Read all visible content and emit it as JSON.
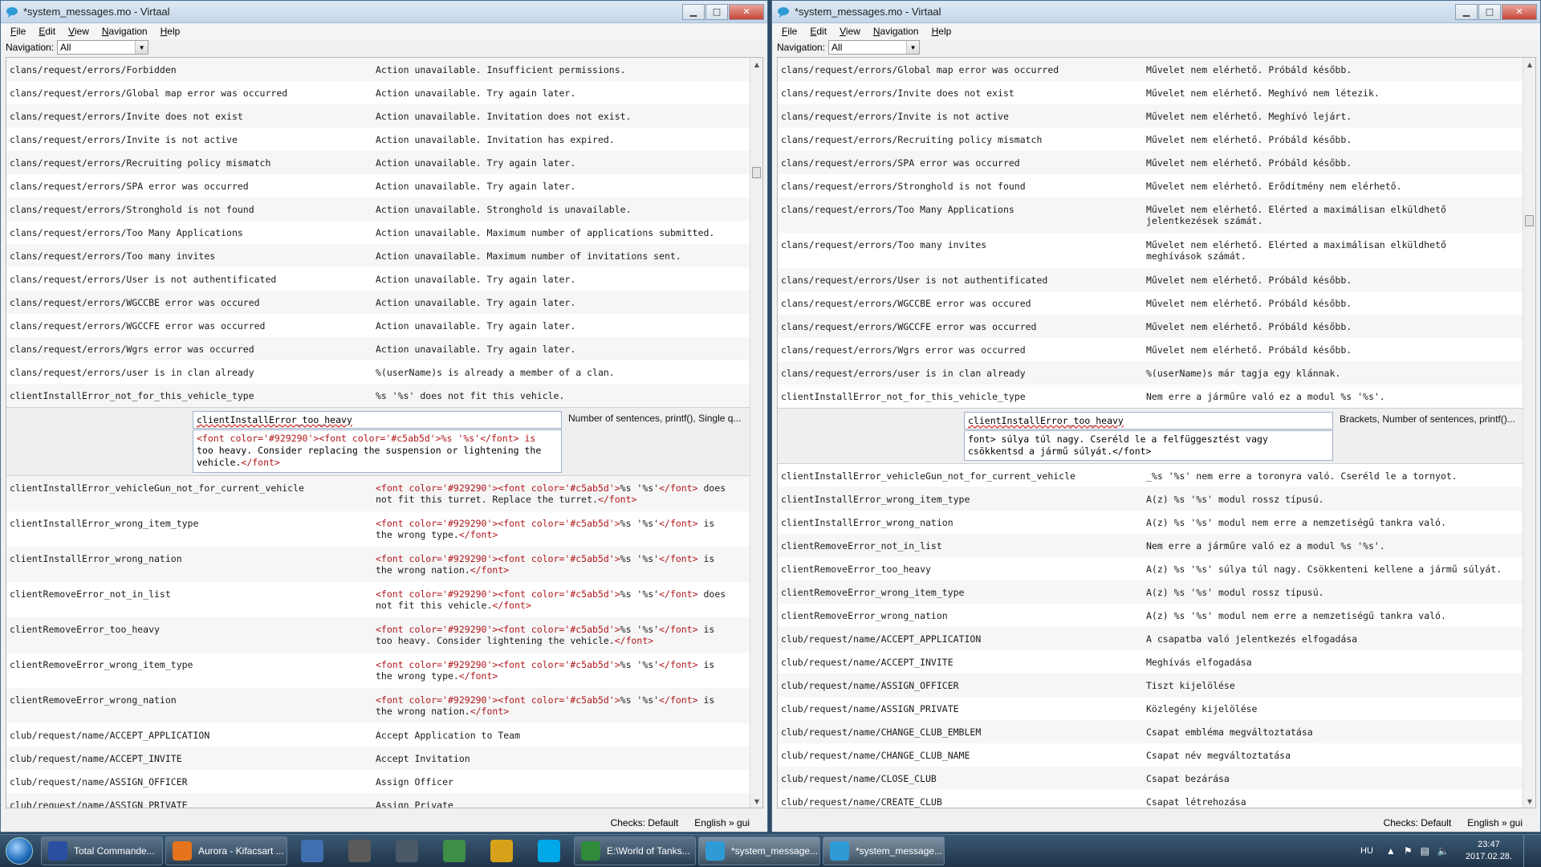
{
  "left_window": {
    "title": "*system_messages.mo - Virtaal",
    "menu": [
      "File",
      "Edit",
      "View",
      "Navigation",
      "Help"
    ],
    "nav_label": "Navigation:",
    "nav_value": "All",
    "rows_before": [
      {
        "key": "clans/request/errors/Forbidden",
        "val": "Action unavailable. Insufficient permissions."
      },
      {
        "key": "clans/request/errors/Global map error was occurred",
        "val": "Action unavailable. Try again later."
      },
      {
        "key": "clans/request/errors/Invite does not exist",
        "val": "Action unavailable. Invitation does not exist."
      },
      {
        "key": "clans/request/errors/Invite is not active",
        "val": "Action unavailable. Invitation has expired."
      },
      {
        "key": "clans/request/errors/Recruiting policy mismatch",
        "val": "Action unavailable. Try again later."
      },
      {
        "key": "clans/request/errors/SPA error was occurred",
        "val": "Action unavailable. Try again later."
      },
      {
        "key": "clans/request/errors/Stronghold is not found",
        "val": "Action unavailable. Stronghold is unavailable."
      },
      {
        "key": "clans/request/errors/Too Many Applications",
        "val": "Action unavailable. Maximum number of applications submitted."
      },
      {
        "key": "clans/request/errors/Too many invites",
        "val": "Action unavailable. Maximum number of invitations sent."
      },
      {
        "key": "clans/request/errors/User is not authentificated",
        "val": "Action unavailable. Try again later."
      },
      {
        "key": "clans/request/errors/WGCCBE error was occured",
        "val": "Action unavailable. Try again later."
      },
      {
        "key": "clans/request/errors/WGCCFE error was occurred",
        "val": "Action unavailable. Try again later."
      },
      {
        "key": "clans/request/errors/Wgrs error was occurred",
        "val": "Action unavailable. Try again later."
      },
      {
        "key": "clans/request/errors/user is in clan already",
        "val": "%(userName)s is already a member of a clan."
      },
      {
        "key": "clientInstallError_not_for_this_vehicle_type",
        "val": "%s '%s' does not fit this vehicle."
      }
    ],
    "editor": {
      "key": "clientInstallError_too_heavy",
      "val_markup": "<font color='#929290'><font color='#c5ab5d'>%s '%s'</font> is",
      "val_rest": "too heavy. Consider replacing the suspension or lightening the",
      "val_end_text": "vehicle.",
      "val_end_tag": "</font>",
      "checks": "Number of sentences, printf(), Single q..."
    },
    "rows_after": [
      {
        "key": "clientInstallError_vehicleGun_not_for_current_vehicle",
        "tag": "<font color='#929290'><font color='#c5ab5d'>",
        "mid": "%s '%s'",
        "close": "</font>",
        "text": " does",
        "text2": "not fit this turret. Replace the turret.",
        "endtag": "</font>"
      },
      {
        "key": "clientInstallError_wrong_item_type",
        "tag": "<font color='#929290'><font color='#c5ab5d'>",
        "mid": "%s '%s'",
        "close": "</font>",
        "text": " is",
        "text2": "the wrong type.",
        "endtag": "</font>"
      },
      {
        "key": "clientInstallError_wrong_nation",
        "tag": "<font color='#929290'><font color='#c5ab5d'>",
        "mid": "%s '%s'",
        "close": "</font>",
        "text": " is",
        "text2": "the wrong nation.",
        "endtag": "</font>"
      },
      {
        "key": "clientRemoveError_not_in_list",
        "tag": "<font color='#929290'><font color='#c5ab5d'>",
        "mid": "%s '%s'",
        "close": "</font>",
        "text": " does",
        "text2": "not fit this vehicle.",
        "endtag": "</font>"
      },
      {
        "key": "clientRemoveError_too_heavy",
        "tag": "<font color='#929290'><font color='#c5ab5d'>",
        "mid": "%s '%s'",
        "close": "</font>",
        "text": " is",
        "text2": "too heavy. Consider lightening the vehicle.",
        "endtag": "</font>"
      },
      {
        "key": "clientRemoveError_wrong_item_type",
        "tag": "<font color='#929290'><font color='#c5ab5d'>",
        "mid": "%s '%s'",
        "close": "</font>",
        "text": " is",
        "text2": "the wrong type.",
        "endtag": "</font>"
      },
      {
        "key": "clientRemoveError_wrong_nation",
        "tag": "<font color='#929290'><font color='#c5ab5d'>",
        "mid": "%s '%s'",
        "close": "</font>",
        "text": " is",
        "text2": "the wrong nation.",
        "endtag": "</font>"
      }
    ],
    "rows_end": [
      {
        "key": "club/request/name/ACCEPT_APPLICATION",
        "val": "Accept Application to Team"
      },
      {
        "key": "club/request/name/ACCEPT_INVITE",
        "val": "Accept Invitation"
      },
      {
        "key": "club/request/name/ASSIGN_OFFICER",
        "val": "Assign Officer"
      },
      {
        "key": "club/request/name/ASSIGN_PRIVATE",
        "val": "Assign Private"
      }
    ],
    "status_checks": "Checks: Default",
    "status_lang": "English » gui"
  },
  "right_window": {
    "title": "*system_messages.mo - Virtaal",
    "menu": [
      "File",
      "Edit",
      "View",
      "Navigation",
      "Help"
    ],
    "nav_label": "Navigation:",
    "nav_value": "All",
    "rows_before": [
      {
        "key": "clans/request/errors/Global map error was occurred",
        "val": "Művelet nem elérhető. Próbáld később."
      },
      {
        "key": "clans/request/errors/Invite does not exist",
        "val": "Művelet nem elérhető. Meghívó nem létezik."
      },
      {
        "key": "clans/request/errors/Invite is not active",
        "val": "Művelet nem elérhető. Meghívó lejárt."
      },
      {
        "key": "clans/request/errors/Recruiting policy mismatch",
        "val": "Művelet nem elérhető. Próbáld később."
      },
      {
        "key": "clans/request/errors/SPA error was occurred",
        "val": "Művelet nem elérhető. Próbáld később."
      },
      {
        "key": "clans/request/errors/Stronghold is not found",
        "val": "Művelet nem elérhető. Erődítmény nem elérhető."
      },
      {
        "key": "clans/request/errors/Too Many Applications",
        "val": "Művelet nem elérhető. Elérted a maximálisan elküldhető\njelentkezések számát.",
        "double": true
      },
      {
        "key": "clans/request/errors/Too many invites",
        "val": "Művelet nem elérhető. Elérted a maximálisan elküldhető\nmeghívások számát.",
        "double": true
      },
      {
        "key": "clans/request/errors/User is not authentificated",
        "val": "Művelet nem elérhető. Próbáld később."
      },
      {
        "key": "clans/request/errors/WGCCBE error was occured",
        "val": "Művelet nem elérhető. Próbáld később."
      },
      {
        "key": "clans/request/errors/WGCCFE error was occurred",
        "val": "Művelet nem elérhető. Próbáld később."
      },
      {
        "key": "clans/request/errors/Wgrs error was occurred",
        "val": "Művelet nem elérhető. Próbáld később."
      },
      {
        "key": "clans/request/errors/user is in clan already",
        "val": "%(userName)s már tagja egy klánnak."
      },
      {
        "key": "clientInstallError_not_for_this_vehicle_type",
        "val": "Nem erre a járműre való ez a modul %s '%s'."
      }
    ],
    "editor": {
      "key": "clientInstallError_too_heavy",
      "line1": "font> súlya túl nagy. Cseréld le a felfüggesztést vagy",
      "line2": "csökkentsd a jármű súlyát.</font>",
      "checks": "Brackets, Number of sentences, printf()..."
    },
    "rows_after": [
      {
        "key": "clientInstallError_vehicleGun_not_for_current_vehicle",
        "val": "_%s '%s' nem erre a toronyra való. Cseréld le a tornyot."
      },
      {
        "key": "clientInstallError_wrong_item_type",
        "val": "A(z) %s '%s' modul rossz típusú."
      },
      {
        "key": "clientInstallError_wrong_nation",
        "val": "A(z) %s '%s' modul nem erre a nemzetiségű tankra való."
      },
      {
        "key": "clientRemoveError_not_in_list",
        "val": "Nem erre a járműre való ez a modul %s '%s'."
      },
      {
        "key": "clientRemoveError_too_heavy",
        "val": "A(z) %s '%s' súlya túl nagy. Csökkenteni kellene a jármű súlyát."
      },
      {
        "key": "clientRemoveError_wrong_item_type",
        "val": "A(z) %s '%s' modul rossz típusú."
      },
      {
        "key": "clientRemoveError_wrong_nation",
        "val": "A(z) %s '%s' modul nem erre a nemzetiségű tankra való."
      },
      {
        "key": "club/request/name/ACCEPT_APPLICATION",
        "val": "A csapatba való jelentkezés elfogadása"
      },
      {
        "key": "club/request/name/ACCEPT_INVITE",
        "val": "Meghívás elfogadása"
      },
      {
        "key": "club/request/name/ASSIGN_OFFICER",
        "val": "Tiszt kijelölése"
      },
      {
        "key": "club/request/name/ASSIGN_PRIVATE",
        "val": "Közlegény kijelölése"
      },
      {
        "key": "club/request/name/CHANGE_CLUB_EMBLEM",
        "val": "Csapat embléma megváltoztatása"
      },
      {
        "key": "club/request/name/CHANGE_CLUB_NAME",
        "val": "Csapat név megváltoztatása"
      },
      {
        "key": "club/request/name/CLOSE_CLUB",
        "val": "Csapat bezárása"
      },
      {
        "key": "club/request/name/CREATE_CLUB",
        "val": "Csapat létrehozása"
      }
    ],
    "status_checks": "Checks: Default",
    "status_lang": "English » gui"
  },
  "taskbar": {
    "items": [
      {
        "label": "Total Commande...",
        "icon": "total-commander-icon",
        "color": "#2a4fa0"
      },
      {
        "label": "Aurora - Kifacsart ...",
        "icon": "firefox-icon",
        "color": "#e5731b"
      },
      {
        "label": "",
        "icon": "thunderbird-icon",
        "color": "#3f6fb0"
      },
      {
        "label": "",
        "icon": "world-of-tanks-icon",
        "color": "#5a5a5a"
      },
      {
        "label": "",
        "icon": "world-of-warships-icon",
        "color": "#4a5868"
      },
      {
        "label": "",
        "icon": "chart-app-icon",
        "color": "#3e8e47"
      },
      {
        "label": "",
        "icon": "sunflower-icon",
        "color": "#d7a21a"
      },
      {
        "label": "",
        "icon": "skype-icon",
        "color": "#00a8e8"
      },
      {
        "label": "E:\\World of Tanks...",
        "icon": "excel-icon",
        "color": "#2f8a3a"
      },
      {
        "label": "*system_message...",
        "icon": "virtaal-icon",
        "color": "#2e9bd6"
      },
      {
        "label": "*system_message...",
        "icon": "virtaal-icon",
        "color": "#2e9bd6"
      }
    ],
    "lang": "HU",
    "time": "23:47",
    "date": "2017.02.28."
  }
}
